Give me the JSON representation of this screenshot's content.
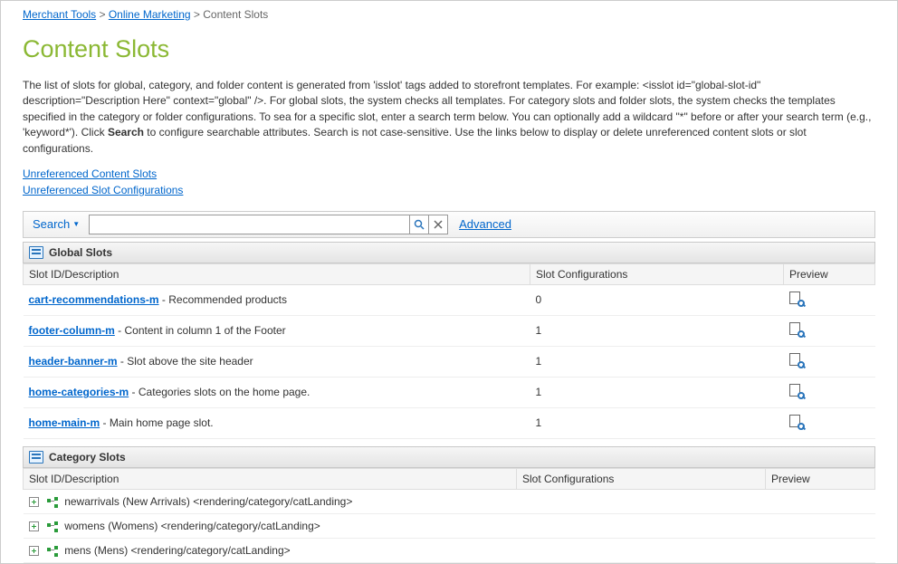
{
  "breadcrumb": {
    "items": [
      {
        "label": "Merchant Tools",
        "link": true
      },
      {
        "label": "Online Marketing",
        "link": true
      },
      {
        "label": "Content Slots",
        "link": false
      }
    ]
  },
  "page": {
    "title": "Content Slots"
  },
  "intro": {
    "text_before_bold": "The list of slots for global, category, and folder content is generated from 'isslot' tags added to storefront templates. For example: <isslot id=\"global-slot-id\" description=\"Description Here\" context=\"global\" />. For global slots, the system checks all templates. For category slots and folder slots, the system checks the templates specified in the category or folder configurations. To sea for a specific slot, enter a search term below. You can optionally add a wildcard \"*\" before or after your search term (e.g., 'keyword*'). Click ",
    "bold_word": "Search",
    "text_after_bold": " to configure searchable attributes. Search is not case-sensitive. Use the links below to display or delete unreferenced content slots or slot configurations."
  },
  "links": {
    "unref_slots": "Unreferenced Content Slots",
    "unref_configs": "Unreferenced Slot Configurations"
  },
  "search": {
    "label": "Search",
    "value": "",
    "advanced": "Advanced"
  },
  "sections": {
    "global": {
      "title": "Global Slots",
      "columns": {
        "id": "Slot ID/Description",
        "cfg": "Slot Configurations",
        "prev": "Preview"
      },
      "rows": [
        {
          "id": "cart-recommendations-m",
          "desc": "Recommended products",
          "cfg": "0"
        },
        {
          "id": "footer-column-m",
          "desc": "Content in column 1 of the Footer",
          "cfg": "1"
        },
        {
          "id": "header-banner-m",
          "desc": "Slot above the site header",
          "cfg": "1"
        },
        {
          "id": "home-categories-m",
          "desc": "Categories slots on the home page.",
          "cfg": "1"
        },
        {
          "id": "home-main-m",
          "desc": "Main home page slot.",
          "cfg": "1"
        }
      ]
    },
    "category": {
      "title": "Category Slots",
      "columns": {
        "id": "Slot ID/Description",
        "cfg": "Slot Configurations",
        "prev": "Preview"
      },
      "rows": [
        {
          "label": "newarrivals (New Arrivals) <rendering/category/catLanding>"
        },
        {
          "label": "womens (Womens) <rendering/category/catLanding>"
        },
        {
          "label": "mens (Mens) <rendering/category/catLanding>"
        }
      ]
    }
  }
}
